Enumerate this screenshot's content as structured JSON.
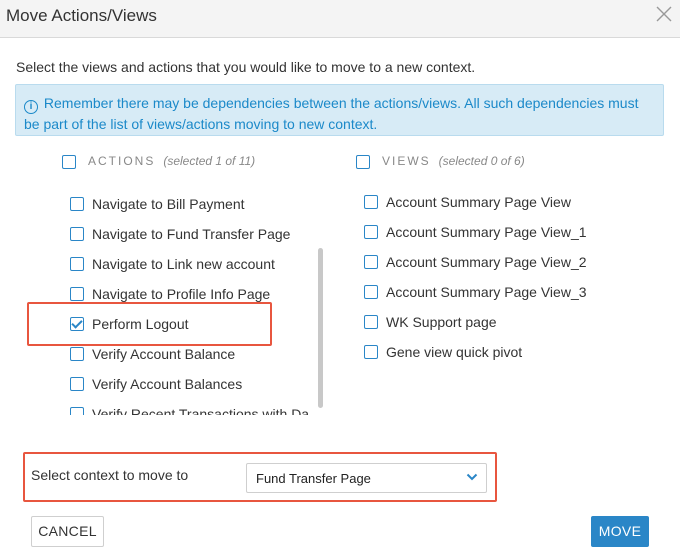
{
  "dialog": {
    "title": "Move Actions/Views",
    "instruction": "Select the views and actions that you would like to move to a new context.",
    "info_text": "Remember there may be dependencies between the actions/views. All such dependencies must be part of the list of views/actions moving to new context."
  },
  "actions": {
    "heading": "ACTIONS",
    "selected_text": "(selected 1 of 11)",
    "items": [
      {
        "label": "Navigate to Bill Payment",
        "checked": false
      },
      {
        "label": "Navigate to Fund Transfer Page",
        "checked": false
      },
      {
        "label": "Navigate to Link new account",
        "checked": false
      },
      {
        "label": "Navigate to Profile Info Page",
        "checked": false
      },
      {
        "label": "Perform Logout",
        "checked": true
      },
      {
        "label": "Verify Account Balance",
        "checked": false
      },
      {
        "label": "Verify Account Balances",
        "checked": false
      },
      {
        "label": "Verify Recent Transactions with Da",
        "checked": false
      }
    ]
  },
  "views": {
    "heading": "VIEWS",
    "selected_text": "(selected 0 of 6)",
    "items": [
      {
        "label": "Account Summary Page View",
        "checked": false
      },
      {
        "label": "Account Summary Page View_1",
        "checked": false
      },
      {
        "label": "Account Summary Page View_2",
        "checked": false
      },
      {
        "label": "Account Summary Page View_3",
        "checked": false
      },
      {
        "label": "WK Support page",
        "checked": false
      },
      {
        "label": "Gene view quick pivot",
        "checked": false
      }
    ]
  },
  "context": {
    "label": "Select context to move to",
    "selected_value": "Fund Transfer Page"
  },
  "buttons": {
    "cancel": "CANCEL",
    "move": "MOVE"
  },
  "icons": {
    "close": "close-icon",
    "info": "info-icon",
    "dropdown": "chevron-down-icon"
  },
  "colors": {
    "accent": "#2a86c7",
    "info_bg": "#d7ebf6",
    "info_text": "#1b89c9",
    "highlight": "#e8563f"
  }
}
